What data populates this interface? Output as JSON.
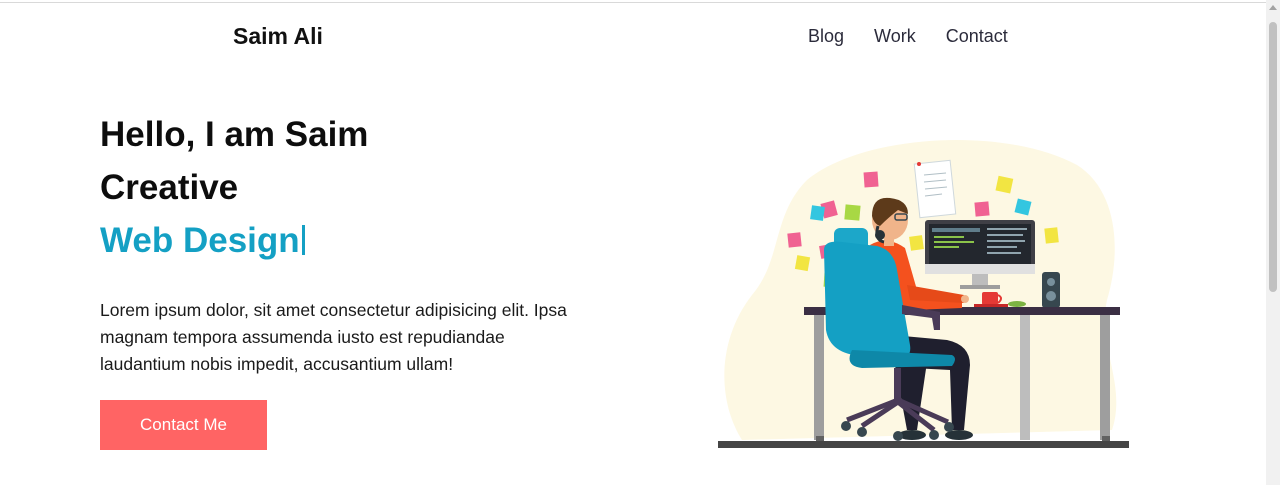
{
  "header": {
    "brand": "Saim Ali",
    "nav": [
      {
        "label": "Blog"
      },
      {
        "label": "Work"
      },
      {
        "label": "Contact"
      }
    ]
  },
  "hero": {
    "greeting": "Hello, I am Saim",
    "line2": "Creative",
    "typed_text": "Web Design",
    "description": "Lorem ipsum dolor, sit amet consectetur adipisicing elit. Ipsa magnam tempora assumenda iusto est repudiandae laudantium nobis impedit, accusantium ullam!",
    "cta_label": "Contact Me"
  },
  "colors": {
    "accent": "#14a0c4",
    "button": "#ff6464",
    "text": "#111111"
  }
}
